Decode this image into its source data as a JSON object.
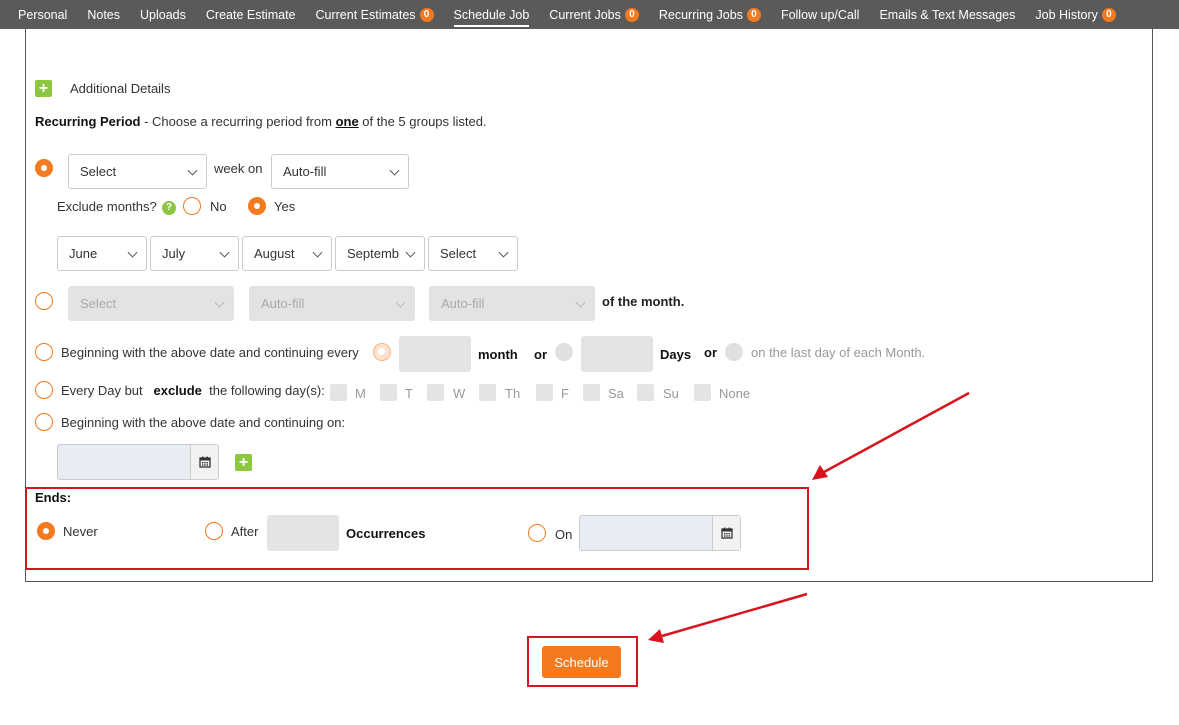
{
  "nav": {
    "items": [
      {
        "label": "Personal"
      },
      {
        "label": "Notes"
      },
      {
        "label": "Uploads"
      },
      {
        "label": "Create Estimate"
      },
      {
        "label": "Current Estimates",
        "badge": "0"
      },
      {
        "label": "Schedule Job",
        "active": true
      },
      {
        "label": "Current Jobs",
        "badge": "0"
      },
      {
        "label": "Recurring Jobs",
        "badge": "0"
      },
      {
        "label": "Follow up/Call"
      },
      {
        "label": "Emails & Text Messages"
      },
      {
        "label": "Job History",
        "badge": "0"
      }
    ]
  },
  "details": {
    "label": "Additional Details"
  },
  "recurring": {
    "title": "Recurring Period",
    "desc_before": " - Choose a recurring period from ",
    "desc_em": "one",
    "desc_after": " of the 5 groups listed."
  },
  "group1": {
    "week_select": "Select",
    "week_on": "week on",
    "autofill": "Auto-fill",
    "exclude_label": "Exclude months?",
    "help": "?",
    "no": "No",
    "yes": "Yes",
    "months": [
      "June",
      "July",
      "August",
      "Septemb",
      "Select"
    ]
  },
  "group2": {
    "s1": "Select",
    "s2": "Auto-fill",
    "s3": "Auto-fill",
    "suffix": "of the month."
  },
  "group3": {
    "text": "Beginning with the above date and continuing every",
    "month": "month",
    "or1": "or",
    "days": "Days",
    "or2": "or",
    "last_day": "on the last day of each Month."
  },
  "group4": {
    "before": "Every Day but",
    "bold": "exclude",
    "after": "the following day(s):",
    "days": [
      "M",
      "T",
      "W",
      "Th",
      "F",
      "Sa",
      "Su",
      "None"
    ]
  },
  "group5": {
    "text": "Beginning with the above date and continuing on:"
  },
  "ends": {
    "title": "Ends:",
    "never": "Never",
    "after": "After",
    "occurrences": "Occurrences",
    "on": "On"
  },
  "schedule_button": "Schedule",
  "colors": {
    "accent": "#f47a1f",
    "annotation": "#d7141e",
    "green": "#8dc63f"
  }
}
